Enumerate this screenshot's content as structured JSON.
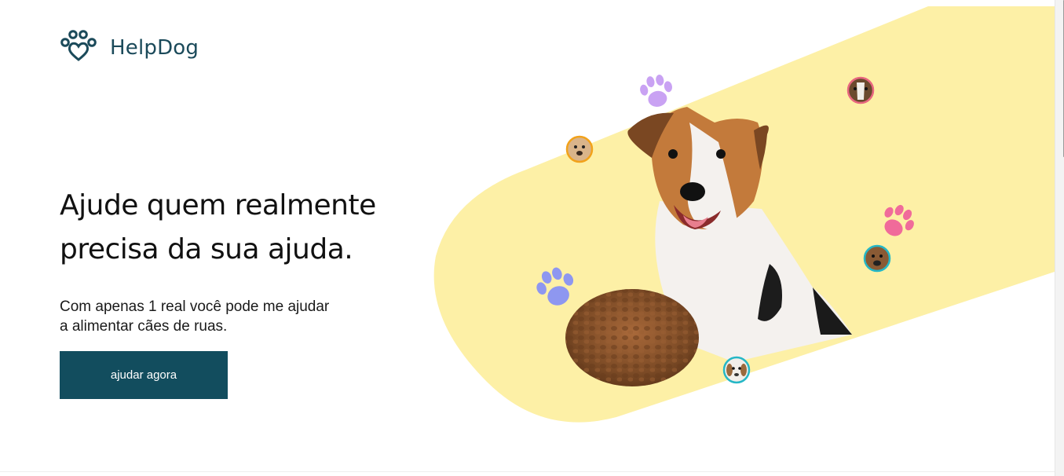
{
  "brand": {
    "name": "HelpDog",
    "logo_icon": "paw-heart-icon",
    "color": "#1b4a5a"
  },
  "hero": {
    "title_line1": "Ajude quem realmente",
    "title_line2": "precisa da sua ajuda.",
    "subtitle_line1": "Com apenas 1 real você pode me ajudar",
    "subtitle_line2": "a alimentar cães de ruas.",
    "cta_label": "ajudar agora",
    "cta_color": "#124d5e"
  },
  "illustration": {
    "background_shape_color": "#fdf0a6",
    "main_image": "jack-russell-dog-photo",
    "food_image": "dog-kibble-pile",
    "paw_colors": [
      "#c9a2f3",
      "#f06b9a",
      "#8e97f0"
    ],
    "avatar_icons": [
      "dog-avatar-icon",
      "dog-avatar-icon",
      "dog-avatar-icon",
      "dog-avatar-icon"
    ]
  }
}
